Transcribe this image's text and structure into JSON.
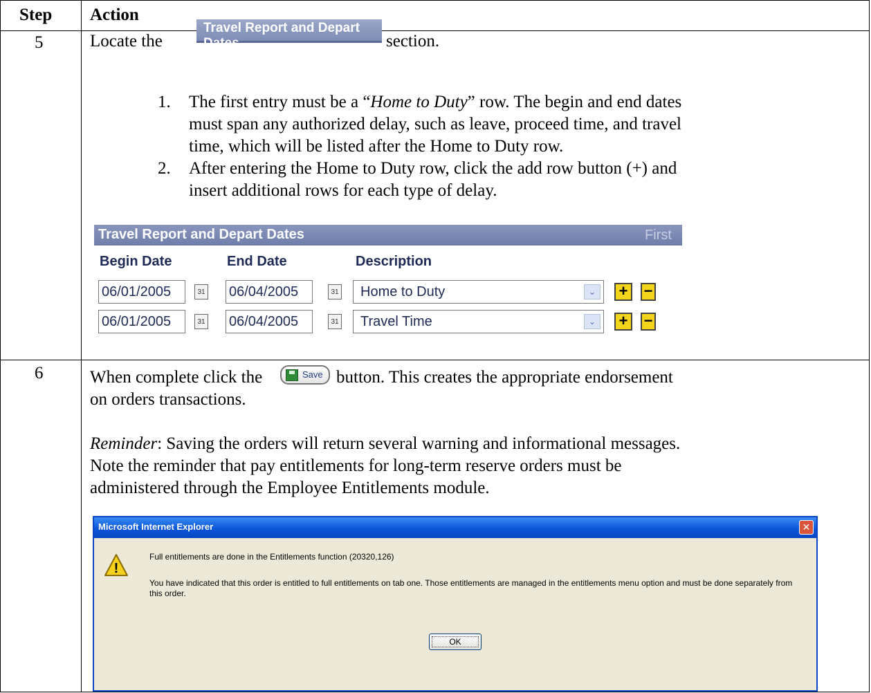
{
  "table": {
    "header_step": "Step",
    "header_action": "Action"
  },
  "step5": {
    "number": "5",
    "locate_before": "Locate the",
    "section_image_label": "Travel Report and Depart Dates",
    "locate_after": "section.",
    "item1_num": "1.",
    "item1_before": "The first entry must be a “",
    "item1_italic": "Home to Duty",
    "item1_line1_after": "” row. The begin and end dates",
    "item1_line2": "must span any authorized delay, such as leave, proceed time, and travel",
    "item1_line3": "time, which will be listed after the Home to Duty row.",
    "item2_num": "2.",
    "item2_line1": "After entering the Home to Duty row, click the add row button (+) and",
    "item2_line2": "insert additional rows for each type of delay."
  },
  "panel": {
    "title": "Travel Report and Depart Dates",
    "first_label": "First",
    "columns": [
      "Begin Date",
      "End Date",
      "Description"
    ],
    "rows": [
      {
        "begin": "06/01/2005",
        "end": "06/04/2005",
        "description": "Home to Duty"
      },
      {
        "begin": "06/01/2005",
        "end": "06/04/2005",
        "description": "Travel Time"
      }
    ],
    "calendar_glyph": "31",
    "add_label": "+",
    "remove_label": "−",
    "dropdown_glyph": "⌄"
  },
  "step6": {
    "number": "6",
    "line1_before": "When complete click the",
    "save_button_label": "Save",
    "line1_after": "button.  This creates the appropriate endorsement",
    "line2": "on orders transactions.",
    "reminder_label": "Reminder",
    "reminder_text": ": Saving the orders will return several warning and informational messages.",
    "reminder_line2": "Note the reminder that pay entitlements for long-term reserve orders must be",
    "reminder_line3": "administered through the Employee Entitlements module."
  },
  "dialog": {
    "title": "Microsoft Internet Explorer",
    "message1": "Full entitlements are done in the Entitlements function (20320,126)",
    "message2": "You have indicated that this order is entitled to full entitlements on tab one. Those entitlements are managed in the entitlements menu option and must be done separately from this order.",
    "ok_label": "OK",
    "close_glyph": "✕",
    "warning_glyph": "!"
  }
}
